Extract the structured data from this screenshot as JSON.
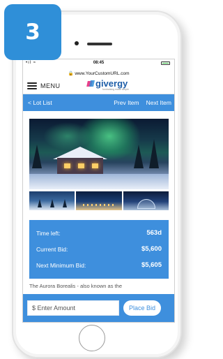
{
  "badge": {
    "number": "3"
  },
  "status_bar": {
    "signal": "•ıl ≈",
    "time": "08:45",
    "url": "🔒 www.YourCustomURL.com"
  },
  "header": {
    "menu_label": "MENU",
    "logo_text": "givergy",
    "logo_tagline": "fundraising made simple"
  },
  "nav": {
    "lot_list": "< Lot List",
    "prev_item": "Prev Item",
    "next_item": "Next Item"
  },
  "bid_info": {
    "time_left_label": "Time left:",
    "time_left_value": "563d",
    "current_bid_label": "Current Bid:",
    "current_bid_value": "$5,600",
    "next_min_label": "Next Minimum Bid:",
    "next_min_value": "$5,605"
  },
  "description_preview": "The Aurora Borealis - also known as the",
  "bid_bar": {
    "amount_placeholder": "$ Enter Amount",
    "place_bid_label": "Place Bid"
  },
  "colors": {
    "accent_blue": "#3e8fdd",
    "badge_blue": "#2f8fd8",
    "logo_pink": "#e8408a",
    "logo_blue": "#1c5da8"
  }
}
